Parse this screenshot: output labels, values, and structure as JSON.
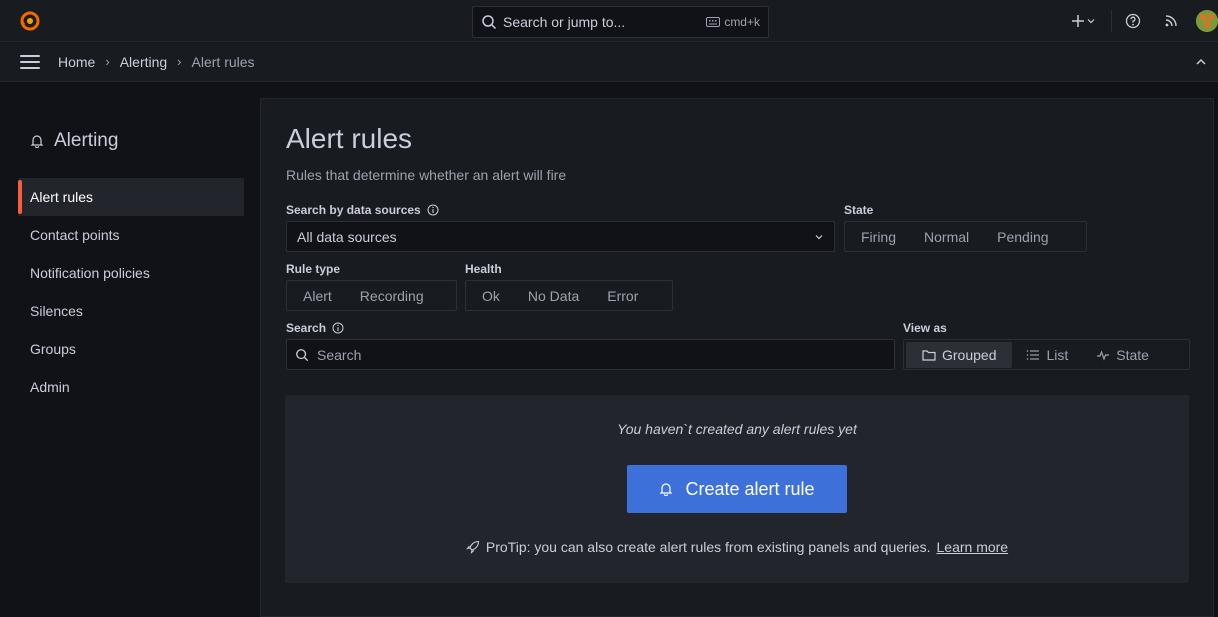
{
  "topbar": {
    "search_placeholder": "Search or jump to...",
    "shortcut": "cmd+k"
  },
  "breadcrumb": [
    "Home",
    "Alerting",
    "Alert rules"
  ],
  "sidenav": {
    "title": "Alerting",
    "items": [
      {
        "label": "Alert rules",
        "active": true
      },
      {
        "label": "Contact points"
      },
      {
        "label": "Notification policies"
      },
      {
        "label": "Silences"
      },
      {
        "label": "Groups"
      },
      {
        "label": "Admin"
      }
    ]
  },
  "page": {
    "title": "Alert rules",
    "subtitle": "Rules that determine whether an alert will fire"
  },
  "filters": {
    "datasource_label": "Search by data sources",
    "datasource_value": "All data sources",
    "state_label": "State",
    "state_options": [
      "Firing",
      "Normal",
      "Pending"
    ],
    "rule_type_label": "Rule type",
    "rule_type_options": [
      "Alert",
      "Recording"
    ],
    "health_label": "Health",
    "health_options": [
      "Ok",
      "No Data",
      "Error"
    ],
    "search_label": "Search",
    "search_placeholder": "Search",
    "view_as_label": "View as",
    "view_as_options": [
      "Grouped",
      "List",
      "State"
    ],
    "view_as_selected": "Grouped"
  },
  "empty_state": {
    "message": "You haven`t created any alert rules yet",
    "cta_label": "Create alert rule",
    "protip_text": "ProTip: you can also create alert rules from existing panels and queries.",
    "protip_link": "Learn more"
  },
  "colors": {
    "accent_orange": "#f55f3e",
    "primary_blue": "#3d71d9",
    "background": "#111217",
    "panel": "#181b1f"
  }
}
